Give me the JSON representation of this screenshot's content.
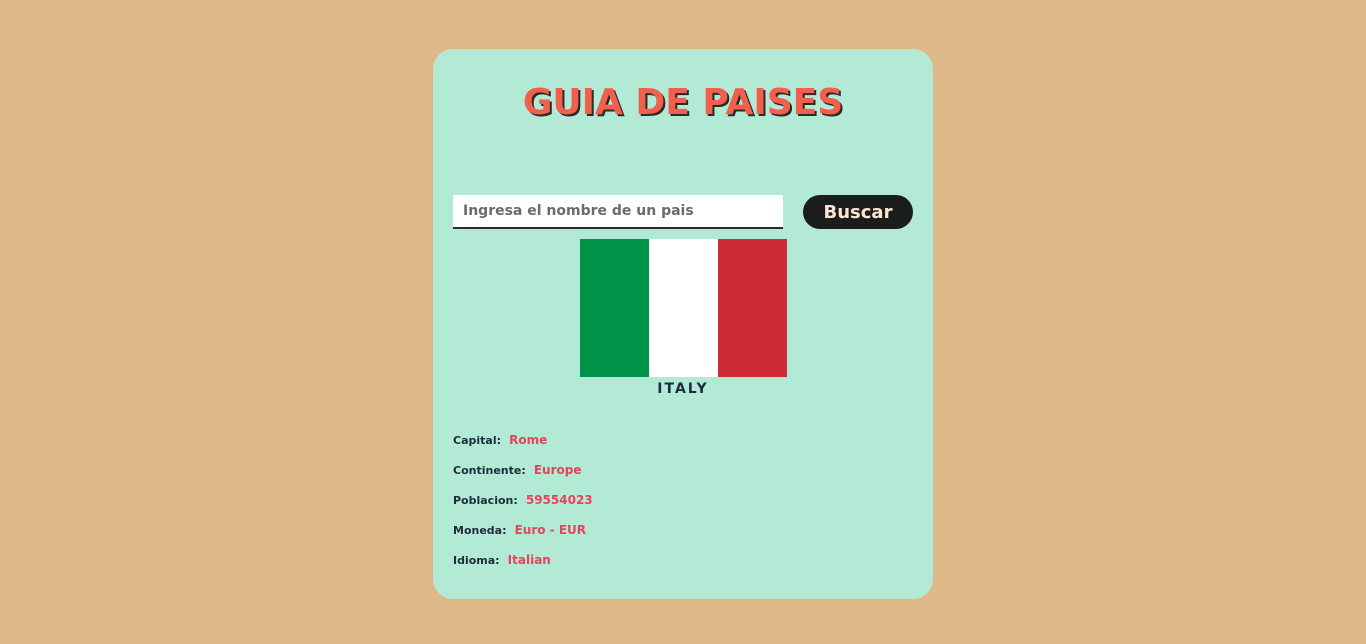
{
  "header": {
    "title": "GUIA DE PAISES"
  },
  "search": {
    "placeholder": "Ingresa el nombre de un pais",
    "value": "",
    "button_label": "Buscar"
  },
  "country": {
    "name": "ITALY",
    "flag_colors": [
      "#009246",
      "#ffffff",
      "#ce2b37"
    ]
  },
  "details": [
    {
      "label": "Capital:",
      "value": "Rome"
    },
    {
      "label": "Continente:",
      "value": "Europe"
    },
    {
      "label": "Poblacion:",
      "value": "59554023"
    },
    {
      "label": "Moneda:",
      "value": "Euro - EUR"
    },
    {
      "label": "Idioma:",
      "value": "Italian"
    }
  ],
  "colors": {
    "page_background": "#dfb887",
    "card_background": "#b2ead5",
    "title": "#f25f4c",
    "button_background": "#1b1d1c",
    "button_text": "#fbe6cf",
    "label": "#1e2b3a",
    "value": "#e8435a"
  }
}
